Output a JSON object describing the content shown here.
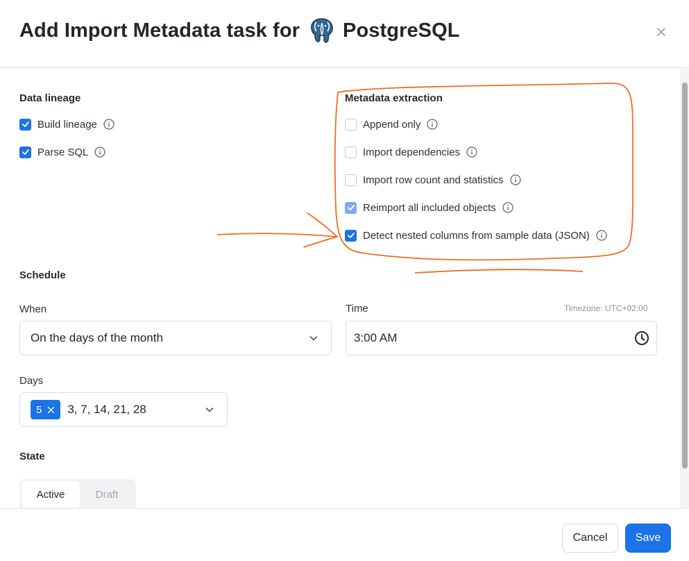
{
  "header": {
    "title_prefix": "Add Import Metadata task for",
    "title_suffix": "PostgreSQL",
    "logo_icon": "postgresql-elephant-icon",
    "close_icon": "close-icon"
  },
  "data_lineage": {
    "title": "Data lineage",
    "options": [
      {
        "label": "Build lineage",
        "checked": true
      },
      {
        "label": "Parse SQL",
        "checked": true
      }
    ]
  },
  "metadata_extraction": {
    "title": "Metadata extraction",
    "options": [
      {
        "label": "Append only",
        "checked": false
      },
      {
        "label": "Import dependencies",
        "checked": false
      },
      {
        "label": "Import row count and statistics",
        "checked": false
      },
      {
        "label": "Reimport all included objects",
        "checked": true,
        "disabled": true
      },
      {
        "label": "Detect nested columns from sample data (JSON)",
        "checked": true
      }
    ]
  },
  "schedule": {
    "title": "Schedule",
    "when_label": "When",
    "when_value": "On the days of the month",
    "time_label": "Time",
    "timezone": "Timezone: UTC+02:00",
    "time_value": "3:00 AM",
    "days_label": "Days",
    "days_count": "5",
    "days_value": "3, 7, 14, 21, 28"
  },
  "state": {
    "title": "State",
    "options": [
      "Active",
      "Draft"
    ],
    "selected": "Active"
  },
  "footer": {
    "cancel_label": "Cancel",
    "save_label": "Save"
  },
  "colors": {
    "primary": "#1a73e8",
    "annotation": "#f06d1e"
  }
}
